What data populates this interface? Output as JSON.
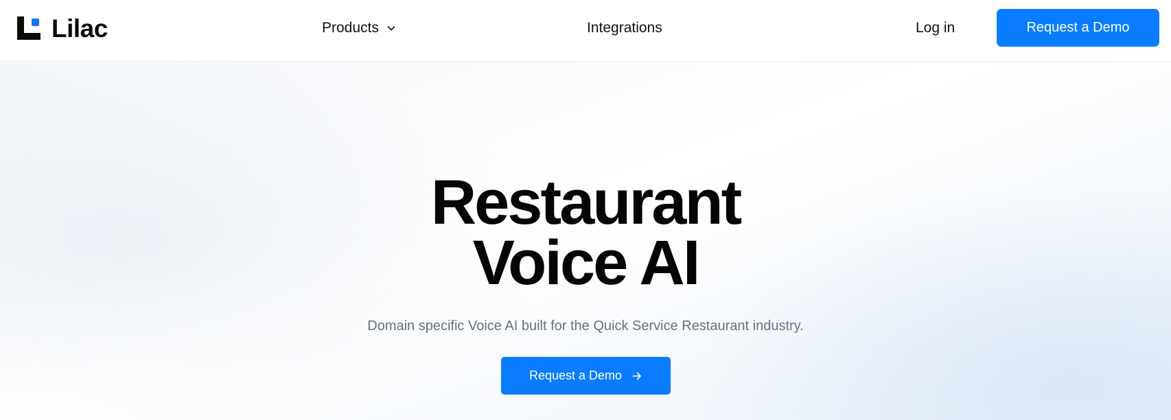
{
  "brand": {
    "name": "Lilac",
    "accent_color": "#1d6ff2"
  },
  "nav": {
    "products_label": "Products",
    "products_icon": "chevron-down-icon",
    "integrations_label": "Integrations",
    "login_label": "Log in",
    "demo_label": "Request a Demo"
  },
  "hero": {
    "title_line1": "Restaurant",
    "title_line2": "Voice AI",
    "subtitle": "Domain specific Voice AI built for the Quick Service Restaurant industry.",
    "cta_label": "Request a Demo",
    "cta_icon": "arrow-right-icon"
  },
  "colors": {
    "primary_button": "#0a7cff",
    "text": "#0a0a0a",
    "muted_text": "#6b6f76"
  }
}
